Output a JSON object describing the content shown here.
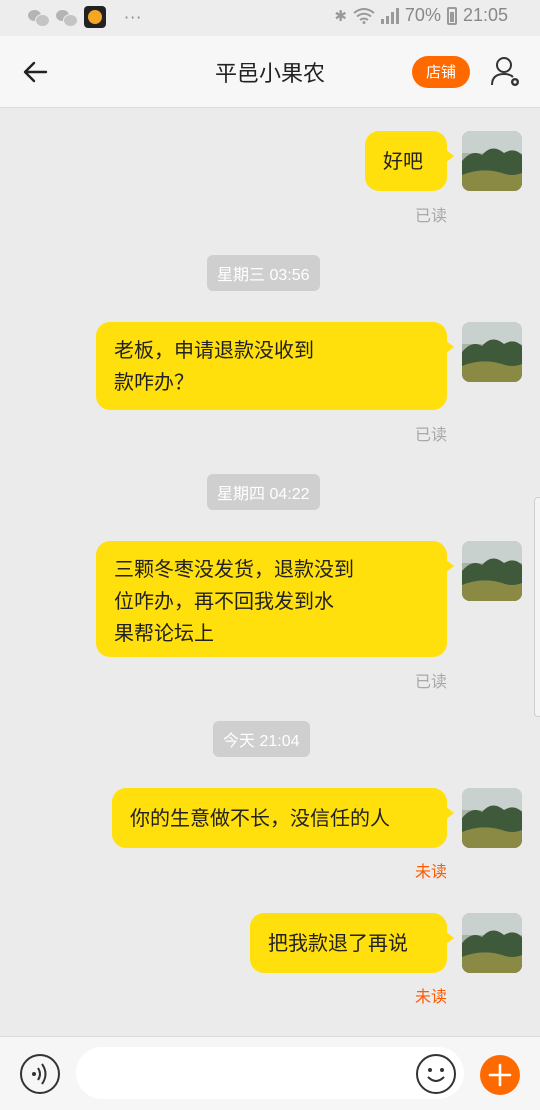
{
  "status_bar": {
    "dots": "···",
    "battery": "70%",
    "time": "21:05"
  },
  "header": {
    "title": "平邑小果农",
    "shop_button": "店铺"
  },
  "messages": [
    {
      "text_lines": [
        "好吧"
      ],
      "status": "已读"
    },
    {
      "text_lines": [
        "老板，申请退款没收到",
        "款咋办？"
      ],
      "status": "已读"
    },
    {
      "text_lines": [
        "三颗冬枣没发货，退款没到",
        "位咋办，再不回我发到水",
        "果帮论坛上"
      ],
      "status": "已读"
    },
    {
      "text_lines": [
        "你的生意做不长，没信任的人"
      ],
      "status": "未读"
    },
    {
      "text_lines": [
        "把我款退了再说"
      ],
      "status": "未读"
    }
  ],
  "timestamps": [
    "星期三 03:56",
    "星期四 04:22",
    "今天  21:04"
  ],
  "input": {
    "placeholder": "",
    "value": ""
  },
  "colors": {
    "bubble": "#ffdf0c",
    "accent": "#ff6a00",
    "unread": "#ff5a00",
    "read": "#a8a8a8",
    "background": "#ebebeb"
  },
  "icons": [
    "wechat-icon",
    "app-icon",
    "bluetooth-icon",
    "wifi-icon",
    "signal-icon",
    "battery-icon",
    "back-arrow-icon",
    "user-settings-icon",
    "voice-icon",
    "emoji-icon",
    "plus-icon"
  ]
}
